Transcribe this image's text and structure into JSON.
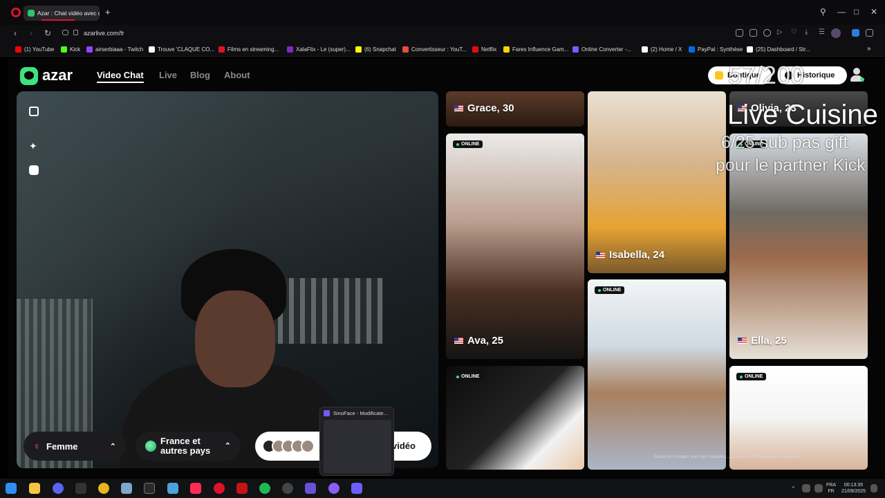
{
  "browser": {
    "tab_title": "Azar : Chat vidéo avec de",
    "url": "azarlive.com/fr",
    "bookmarks": [
      {
        "label": "(1) YouTube",
        "color": "#ff0000"
      },
      {
        "label": "Kick",
        "color": "#53fc18"
      },
      {
        "label": "airserbiaaa - Twitch",
        "color": "#9146ff"
      },
      {
        "label": "Trouve 'CLAQUE CO...",
        "color": "#ffffff"
      },
      {
        "label": "Films en streaming...",
        "color": "#e0112b"
      },
      {
        "label": "XalaFlix - Le (super)...",
        "color": "#7b2cbf"
      },
      {
        "label": "(6) Snapchat",
        "color": "#fffc00"
      },
      {
        "label": "Convertisseur : YouT...",
        "color": "#e74c3c"
      },
      {
        "label": "Netflix",
        "color": "#e50914"
      },
      {
        "label": "Fares Influence Gam...",
        "color": "#ffd400"
      },
      {
        "label": "Online Converter -...",
        "color": "#6c63ff"
      },
      {
        "label": "(2) Home / X",
        "color": "#ffffff"
      },
      {
        "label": "PayPal : Synthèse",
        "color": "#0070e0"
      },
      {
        "label": "(25) Dashboard / Str...",
        "color": "#ffffff"
      }
    ]
  },
  "site": {
    "logo": "azar",
    "nav": [
      "Video Chat",
      "Live",
      "Blog",
      "About"
    ],
    "shop_label": "Boutique",
    "history_label": "Historique"
  },
  "filters": {
    "gender": "Femme",
    "region": "France et autres pays",
    "start_label": "vidéo"
  },
  "profiles": [
    {
      "name": "Grace, 30",
      "online": false
    },
    {
      "name": "Olivia, 23",
      "online": false
    },
    {
      "name": "Ava, 25",
      "online": true
    },
    {
      "name": "Isabella, 24",
      "online": false
    },
    {
      "name": "Ella, 25",
      "online": true
    },
    {
      "name": "",
      "online": true
    },
    {
      "name": "",
      "online": true
    },
    {
      "name": "",
      "online": true
    }
  ],
  "online_label": "ONLINE",
  "disclaimer": "Toutes les images sont des modèles ... à des fins d'illustration uniquement",
  "overlay": {
    "line1": "57/200",
    "line2": "Live Cuisine",
    "line3": "6/25 sub pas gift",
    "line4": "pour le partner Kick"
  },
  "preview": {
    "title": "SinoFace - Modificate..."
  },
  "taskbar": {
    "lang_1": "FRA",
    "lang_2": "FR",
    "time": "00:13:35",
    "date": "21/09/2025"
  }
}
